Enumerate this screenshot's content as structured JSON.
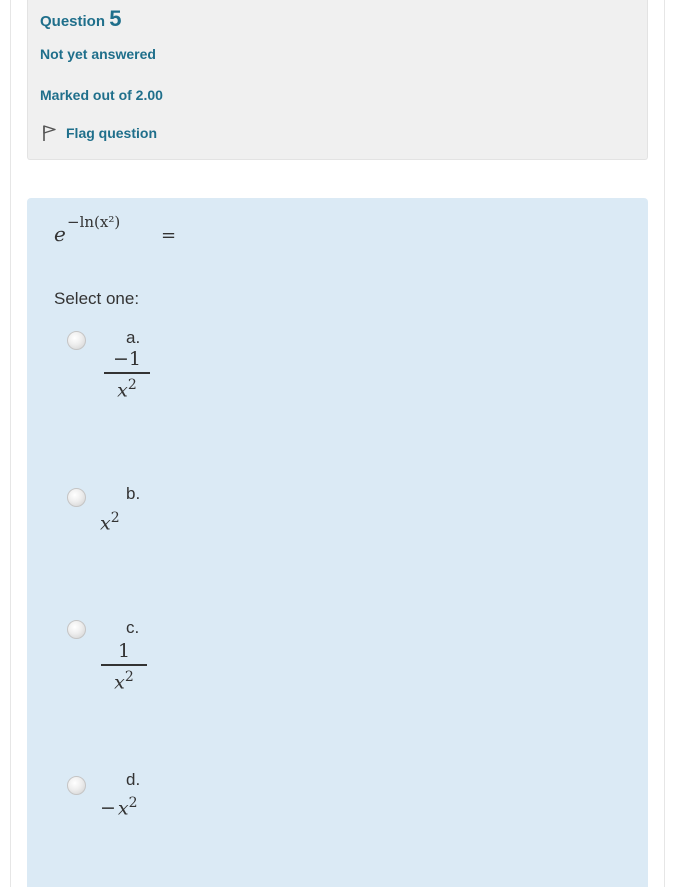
{
  "info": {
    "question_label": "Question",
    "question_number": "5",
    "state": "Not yet answered",
    "grade": "Marked out of 2.00",
    "flag_label": "Flag question"
  },
  "question": {
    "base": "e",
    "exponent": "−ln(x²)",
    "equals": "=",
    "prompt": "Select one:"
  },
  "options": [
    {
      "letter": "a.",
      "numerator": "−1",
      "denominator": "x",
      "power": "2"
    },
    {
      "letter": "b.",
      "base": "x",
      "power": "2"
    },
    {
      "letter": "c.",
      "numerator": "1",
      "denominator": "x",
      "power": "2"
    },
    {
      "letter": "d.",
      "sign": "−",
      "base": "x",
      "power": "2"
    }
  ],
  "colors": {
    "link": "#1f6f8b",
    "info_background": "#f0f0f0",
    "formulation_background": "#dbeaf5"
  }
}
